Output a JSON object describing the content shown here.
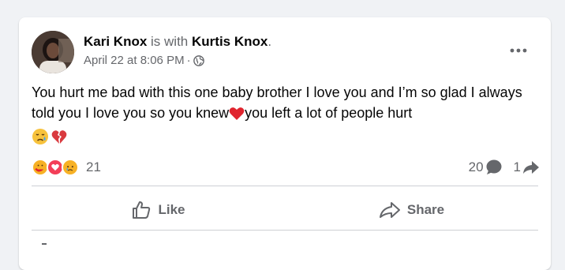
{
  "post": {
    "author": "Kari Knox",
    "with_text": "is with",
    "tagged": "Kurtis Knox",
    "period": ".",
    "date": "April 22 at 8:06 PM",
    "dot": "·",
    "privacy_icon": "globe-icon",
    "text_part1": "You hurt me bad with this one baby brother I love you and I’m so glad I always told you I love you so you knew",
    "text_part2": "you left a lot of people hurt",
    "inline_emoji": "red-heart-icon",
    "trailing_emojis": [
      "crying-face-icon",
      "broken-heart-icon"
    ]
  },
  "reactions": {
    "icons": [
      "care-reaction-icon",
      "love-reaction-icon",
      "sad-reaction-icon"
    ],
    "count": "21"
  },
  "stats": {
    "comments": "20",
    "shares": "1"
  },
  "actions": {
    "like_label": "Like",
    "share_label": "Share"
  },
  "colors": {
    "background": "#f0f2f5",
    "card": "#ffffff",
    "muted": "#65676b",
    "divider": "#ced0d4",
    "love": "#f33e58",
    "reaction_yellow": "#f7b125"
  }
}
